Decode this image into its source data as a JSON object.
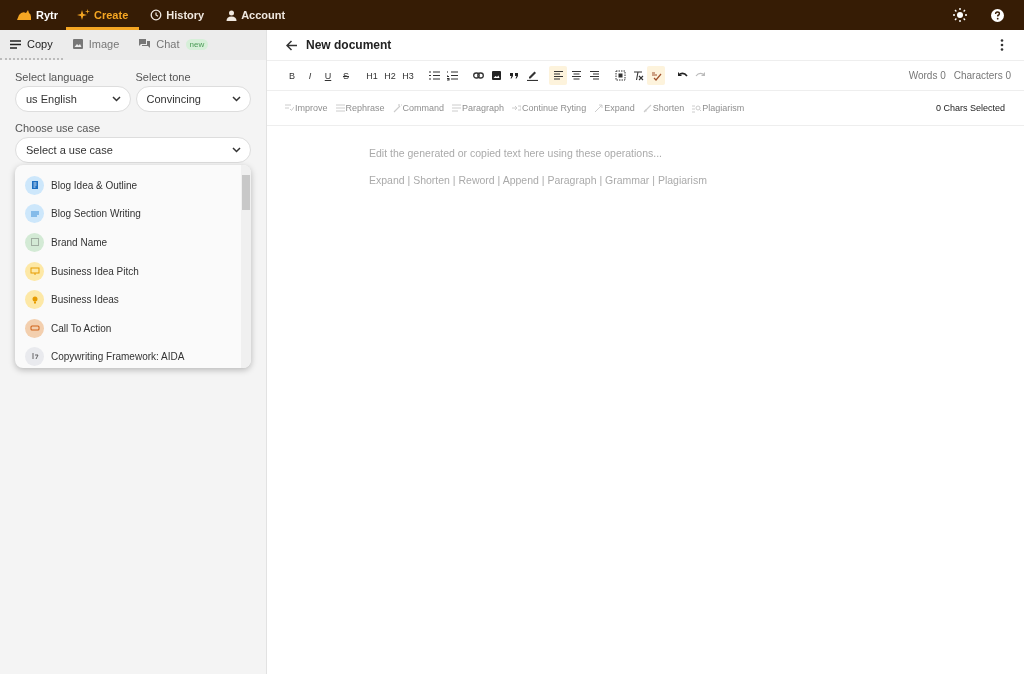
{
  "topbar": {
    "logo": "Rytr",
    "tabs": [
      {
        "label": "Create",
        "selected": true
      },
      {
        "label": "History",
        "selected": false
      },
      {
        "label": "Account",
        "selected": false
      }
    ]
  },
  "sidebar": {
    "tabs": [
      {
        "label": "Copy",
        "selected": true
      },
      {
        "label": "Image",
        "selected": false
      },
      {
        "label": "Chat",
        "selected": false,
        "badge": "new"
      }
    ],
    "language": {
      "label": "Select language",
      "value": "us English"
    },
    "tone": {
      "label": "Select tone",
      "value": "Convincing"
    },
    "use_case": {
      "label": "Choose use case",
      "placeholder": "Select a use case",
      "options": [
        {
          "label": "Blog Idea & Outline",
          "color": "#cde7fb"
        },
        {
          "label": "Blog Section Writing",
          "color": "#cde7fb"
        },
        {
          "label": "Brand Name",
          "color": "#d3ead5"
        },
        {
          "label": "Business Idea Pitch",
          "color": "#fde8a6"
        },
        {
          "label": "Business Ideas",
          "color": "#fde8a6"
        },
        {
          "label": "Call To Action",
          "color": "#f3cfae"
        },
        {
          "label": "Copywriting Framework: AIDA",
          "color": "#e9eaee"
        }
      ]
    }
  },
  "editor": {
    "title": "New document",
    "toolbar": [
      {
        "kind": "text",
        "label": "B",
        "active": false
      },
      {
        "kind": "text",
        "label": "I",
        "active": false
      },
      {
        "kind": "text",
        "label": "U",
        "active": false
      },
      {
        "kind": "text",
        "label": "S",
        "active": false
      },
      {
        "kind": "text",
        "label": "H1",
        "active": false
      },
      {
        "kind": "text",
        "label": "H2",
        "active": false
      },
      {
        "kind": "text",
        "label": "H3",
        "active": false
      },
      {
        "kind": "icon",
        "active": false
      },
      {
        "kind": "icon",
        "active": false
      },
      {
        "kind": "icon",
        "active": false
      },
      {
        "kind": "icon",
        "active": false
      },
      {
        "kind": "icon",
        "active": false
      },
      {
        "kind": "icon",
        "active": false
      },
      {
        "kind": "icon",
        "active": true
      },
      {
        "kind": "icon",
        "active": false
      },
      {
        "kind": "icon",
        "active": false
      },
      {
        "kind": "icon",
        "active": false
      },
      {
        "kind": "icon",
        "active": false
      },
      {
        "kind": "icon",
        "active": true
      },
      {
        "kind": "icon",
        "active": false
      },
      {
        "kind": "icon",
        "active": false
      }
    ],
    "words": "Words 0",
    "characters": "Characters 0",
    "actions": [
      {
        "label": "Improve",
        "disabled": true
      },
      {
        "label": "Rephrase",
        "disabled": true
      },
      {
        "label": "Command",
        "disabled": true
      },
      {
        "label": "Paragraph",
        "disabled": true
      },
      {
        "label": "Continue Ryting",
        "disabled": true
      },
      {
        "label": "Expand",
        "disabled": true
      },
      {
        "label": "Shorten",
        "disabled": true
      },
      {
        "label": "Plagiarism",
        "disabled": true
      }
    ],
    "selection": "0 Chars Selected",
    "placeholder_lines": [
      "Edit the generated or copied text here using these operations...",
      "Expand | Shorten | Reword | Append | Paragraph | Grammar | Plagiarism"
    ]
  }
}
